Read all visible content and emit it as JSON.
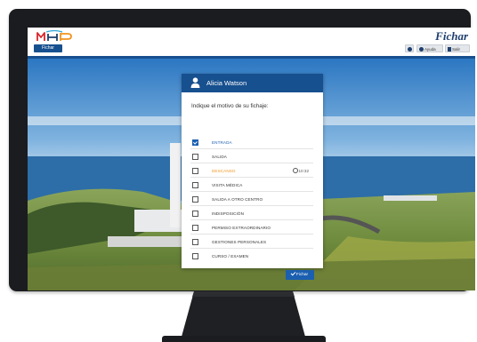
{
  "app": {
    "logo_text": "MHP",
    "brand": "Fichar",
    "tab_label": "Fichar",
    "header_buttons": {
      "refresh_icon": "refresh-icon",
      "help_label": "Ayuda",
      "help_icon": "help-circle-icon",
      "exit_label": "Salir",
      "exit_icon": "logout-icon"
    }
  },
  "card": {
    "user_name": "Alicia Watson",
    "user_icon": "user-icon",
    "prompt": "Indique el motivo de su fichaje:",
    "options": [
      {
        "label": "ENTRADA",
        "checked": true,
        "time": ""
      },
      {
        "label": "SALIDA",
        "checked": false,
        "time": ""
      },
      {
        "label": "DESCANSO",
        "checked": false,
        "time": "10:32"
      },
      {
        "label": "VISITA MÉDICA",
        "checked": false,
        "time": ""
      },
      {
        "label": "SALIDA A OTRO CENTRO",
        "checked": false,
        "time": ""
      },
      {
        "label": "INDISPOSICIÓN",
        "checked": false,
        "time": ""
      },
      {
        "label": "PERMISO EXTRAORDINARIO",
        "checked": false,
        "time": ""
      },
      {
        "label": "GESTIONES PERSONALES",
        "checked": false,
        "time": ""
      },
      {
        "label": "CURSO / EXAMEN",
        "checked": false,
        "time": ""
      }
    ],
    "submit_label": "Fichar",
    "submit_icon": "check-icon"
  },
  "colors": {
    "primary": "#17508f",
    "accent": "#1b5fb0",
    "warning": "#f0941e",
    "monitor": "#1b1c1f"
  }
}
